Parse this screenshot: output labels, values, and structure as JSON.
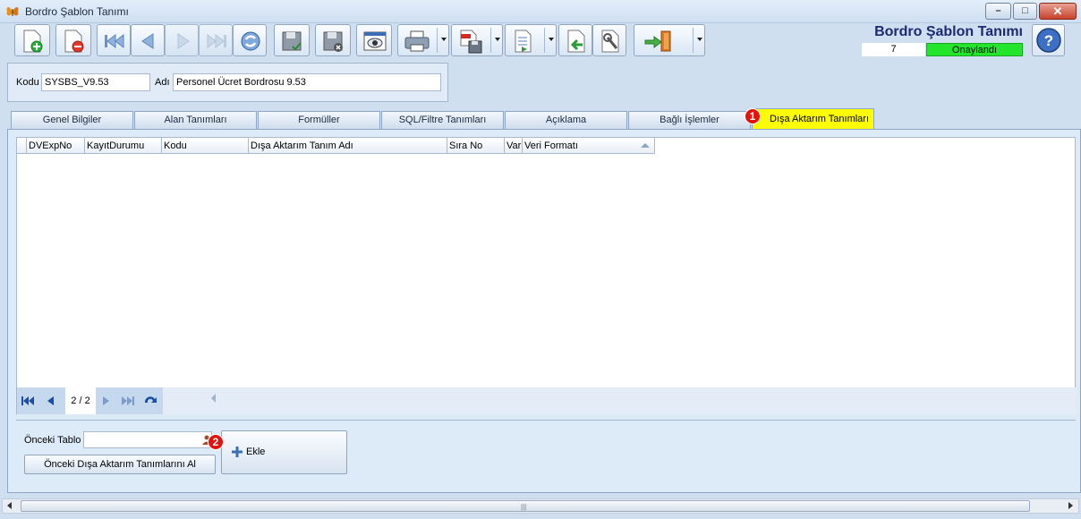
{
  "window": {
    "title": "Bordro Şablon Tanımı",
    "min_label": "–",
    "max_label": "□",
    "close_label": "✕"
  },
  "header": {
    "title": "Bordro Şablon Tanımı",
    "record_count": "7",
    "status": "Onaylandı",
    "status_color": "#22e52c"
  },
  "form": {
    "code_label": "Kodu",
    "code_value": "SYSBS_V9.53",
    "name_label": "Adı",
    "name_value": "Personel Ücret Bordrosu 9.53"
  },
  "tabs": [
    {
      "label": "Genel Bilgiler"
    },
    {
      "label": "Alan Tanımları"
    },
    {
      "label": "Formüller"
    },
    {
      "label": "SQL/Filtre Tanımları"
    },
    {
      "label": "Açıklama"
    },
    {
      "label": "Bağlı İşlemler"
    },
    {
      "label": "Dışa Aktarım Tanımları",
      "active": true
    }
  ],
  "badges": {
    "one": "1",
    "two": "2"
  },
  "grid": {
    "columns": [
      "DVExpNo",
      "KayıtDurumu",
      "Kodu",
      "Dışa Aktarım Tanım Adı",
      "Sıra No",
      "Var",
      "Veri Formatı"
    ],
    "rows": [],
    "page_info": "2 / 2"
  },
  "bottom": {
    "prev_table_label": "Önceki Tablo",
    "prev_table_value": "",
    "get_prev_button": "Önceki Dışa Aktarım Tanımlarını Al",
    "add_button": "Ekle"
  },
  "colors": {
    "accent_tab": "#fdfd08",
    "badge": "#e3120b",
    "title": "#1b2a73"
  }
}
